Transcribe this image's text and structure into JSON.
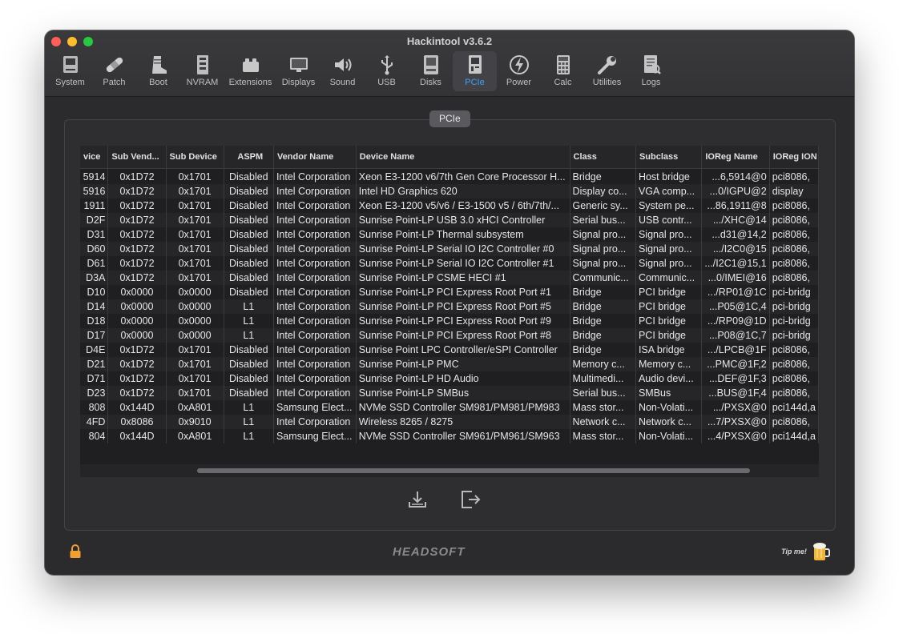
{
  "app": {
    "title": "Hackintool v3.6.2"
  },
  "toolbar": {
    "items": [
      {
        "label": "System",
        "icon": "system-icon"
      },
      {
        "label": "Patch",
        "icon": "bandage-icon"
      },
      {
        "label": "Boot",
        "icon": "boot-icon"
      },
      {
        "label": "NVRAM",
        "icon": "nvram-icon"
      },
      {
        "label": "Extensions",
        "icon": "lego-icon"
      },
      {
        "label": "Displays",
        "icon": "display-icon"
      },
      {
        "label": "Sound",
        "icon": "speaker-icon"
      },
      {
        "label": "USB",
        "icon": "usb-icon"
      },
      {
        "label": "Disks",
        "icon": "disk-icon"
      },
      {
        "label": "PCIe",
        "icon": "pcie-card-icon",
        "active": true
      },
      {
        "label": "Power",
        "icon": "power-bolt-icon"
      },
      {
        "label": "Calc",
        "icon": "calculator-icon"
      },
      {
        "label": "Utilities",
        "icon": "wrench-icon"
      },
      {
        "label": "Logs",
        "icon": "logs-icon"
      }
    ],
    "active_color": "#3aa2ff"
  },
  "panel": {
    "title": "PCIe"
  },
  "table": {
    "columns": [
      "vice",
      "Sub Vend...",
      "Sub Device",
      "ASPM",
      "Vendor Name",
      "Device Name",
      "Class",
      "Subclass",
      "IOReg Name",
      "IOReg ION"
    ],
    "rows": [
      [
        "5914",
        "0x1D72",
        "0x1701",
        "Disabled",
        "Intel Corporation",
        "Xeon E3-1200 v6/7th Gen Core Processor H...",
        "Bridge",
        "Host bridge",
        "...6,5914@0",
        "pci8086,"
      ],
      [
        "5916",
        "0x1D72",
        "0x1701",
        "Disabled",
        "Intel Corporation",
        "Intel HD Graphics 620",
        "Display co...",
        "VGA comp...",
        "...0/IGPU@2",
        "display"
      ],
      [
        "1911",
        "0x1D72",
        "0x1701",
        "Disabled",
        "Intel Corporation",
        "Xeon E3-1200 v5/v6 / E3-1500 v5 / 6th/7th/...",
        "Generic sy...",
        "System pe...",
        "...86,1911@8",
        "pci8086,"
      ],
      [
        "D2F",
        "0x1D72",
        "0x1701",
        "Disabled",
        "Intel Corporation",
        "Sunrise Point-LP USB 3.0 xHCI Controller",
        "Serial bus...",
        "USB contr...",
        ".../XHC@14",
        "pci8086,"
      ],
      [
        "D31",
        "0x1D72",
        "0x1701",
        "Disabled",
        "Intel Corporation",
        "Sunrise Point-LP Thermal subsystem",
        "Signal pro...",
        "Signal pro...",
        "...d31@14,2",
        "pci8086,"
      ],
      [
        "D60",
        "0x1D72",
        "0x1701",
        "Disabled",
        "Intel Corporation",
        "Sunrise Point-LP Serial IO I2C Controller #0",
        "Signal pro...",
        "Signal pro...",
        ".../I2C0@15",
        "pci8086,"
      ],
      [
        "D61",
        "0x1D72",
        "0x1701",
        "Disabled",
        "Intel Corporation",
        "Sunrise Point-LP Serial IO I2C Controller #1",
        "Signal pro...",
        "Signal pro...",
        ".../I2C1@15,1",
        "pci8086,"
      ],
      [
        "D3A",
        "0x1D72",
        "0x1701",
        "Disabled",
        "Intel Corporation",
        "Sunrise Point-LP CSME HECI #1",
        "Communic...",
        "Communic...",
        "...0/IMEI@16",
        "pci8086,"
      ],
      [
        "D10",
        "0x0000",
        "0x0000",
        "Disabled",
        "Intel Corporation",
        "Sunrise Point-LP PCI Express Root Port #1",
        "Bridge",
        "PCI bridge",
        ".../RP01@1C",
        "pci-bridg"
      ],
      [
        "D14",
        "0x0000",
        "0x0000",
        "L1",
        "Intel Corporation",
        "Sunrise Point-LP PCI Express Root Port #5",
        "Bridge",
        "PCI bridge",
        "...P05@1C,4",
        "pci-bridg"
      ],
      [
        "D18",
        "0x0000",
        "0x0000",
        "L1",
        "Intel Corporation",
        "Sunrise Point-LP PCI Express Root Port #9",
        "Bridge",
        "PCI bridge",
        ".../RP09@1D",
        "pci-bridg"
      ],
      [
        "D17",
        "0x0000",
        "0x0000",
        "L1",
        "Intel Corporation",
        "Sunrise Point-LP PCI Express Root Port #8",
        "Bridge",
        "PCI bridge",
        "...P08@1C,7",
        "pci-bridg"
      ],
      [
        "D4E",
        "0x1D72",
        "0x1701",
        "Disabled",
        "Intel Corporation",
        "Sunrise Point LPC Controller/eSPI Controller",
        "Bridge",
        "ISA bridge",
        ".../LPCB@1F",
        "pci8086,"
      ],
      [
        "D21",
        "0x1D72",
        "0x1701",
        "Disabled",
        "Intel Corporation",
        "Sunrise Point-LP PMC",
        "Memory c...",
        "Memory c...",
        "...PMC@1F,2",
        "pci8086,"
      ],
      [
        "D71",
        "0x1D72",
        "0x1701",
        "Disabled",
        "Intel Corporation",
        "Sunrise Point-LP HD Audio",
        "Multimedi...",
        "Audio devi...",
        "...DEF@1F,3",
        "pci8086,"
      ],
      [
        "D23",
        "0x1D72",
        "0x1701",
        "Disabled",
        "Intel Corporation",
        "Sunrise Point-LP SMBus",
        "Serial bus...",
        "SMBus",
        "...BUS@1F,4",
        "pci8086,"
      ],
      [
        "808",
        "0x144D",
        "0xA801",
        "L1",
        "Samsung Elect...",
        "NVMe SSD Controller SM981/PM981/PM983",
        "Mass stor...",
        "Non-Volati...",
        ".../PXSX@0",
        "pci144d,a"
      ],
      [
        "4FD",
        "0x8086",
        "0x9010",
        "L1",
        "Intel Corporation",
        "Wireless 8265 / 8275",
        "Network c...",
        "Network c...",
        "...7/PXSX@0",
        "pci8086,"
      ],
      [
        "804",
        "0x144D",
        "0xA801",
        "L1",
        "Samsung Elect...",
        "NVMe SSD Controller SM961/PM961/SM963",
        "Mass stor...",
        "Non-Volati...",
        "...4/PXSX@0",
        "pci144d,a"
      ]
    ]
  },
  "actions": {
    "export": "export-icon",
    "exit": "exit-icon"
  },
  "footer": {
    "brand": "HEADSOFT",
    "tip": "Tip me!",
    "lock_color": "#f0a030"
  }
}
